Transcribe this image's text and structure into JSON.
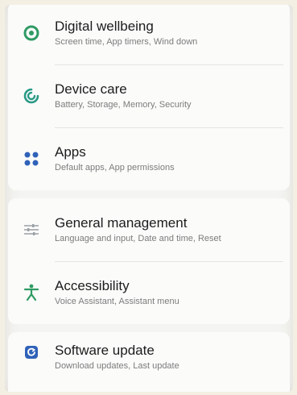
{
  "settings": {
    "groups": [
      {
        "items": [
          {
            "title": "Digital wellbeing",
            "subtitle": "Screen time, App timers, Wind down",
            "icon": "digital-wellbeing-icon"
          },
          {
            "title": "Device care",
            "subtitle": "Battery, Storage, Memory, Security",
            "icon": "device-care-icon"
          },
          {
            "title": "Apps",
            "subtitle": "Default apps, App permissions",
            "icon": "apps-icon"
          }
        ]
      },
      {
        "items": [
          {
            "title": "General management",
            "subtitle": "Language and input, Date and time, Reset",
            "icon": "general-management-icon"
          },
          {
            "title": "Accessibility",
            "subtitle": "Voice Assistant, Assistant menu",
            "icon": "accessibility-icon"
          }
        ]
      },
      {
        "items": [
          {
            "title": "Software update",
            "subtitle": "Download updates, Last update",
            "icon": "software-update-icon"
          }
        ]
      }
    ]
  },
  "colors": {
    "green": "#2f9b63",
    "teal": "#2a9a86",
    "blue": "#2f62b8",
    "gray": "#9aa0a5"
  }
}
